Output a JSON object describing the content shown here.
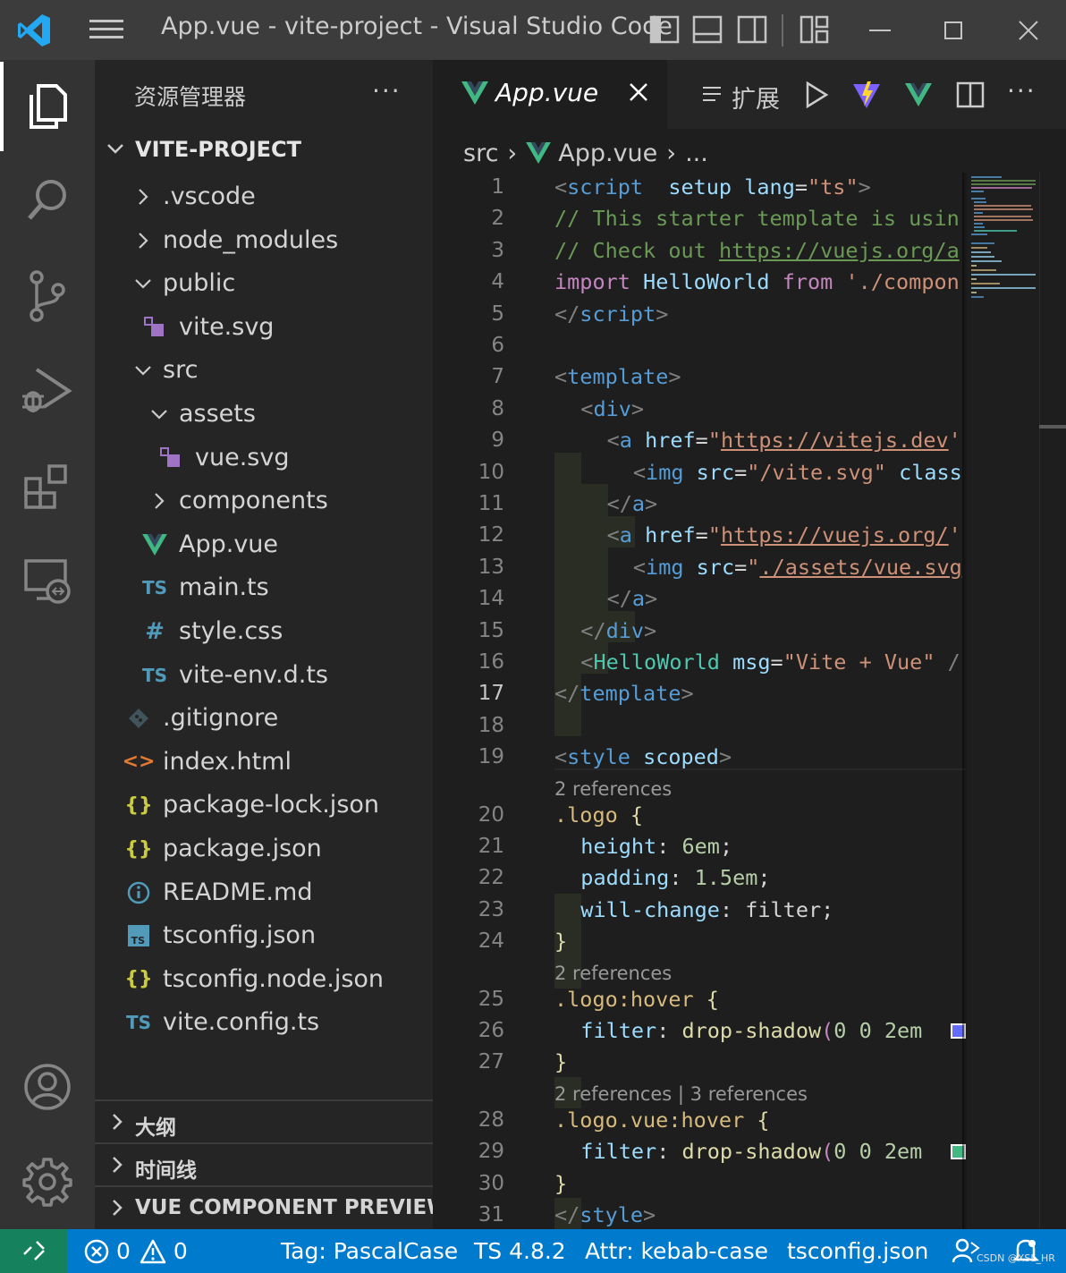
{
  "window": {
    "title": "App.vue - vite-project - Visual Studio Code"
  },
  "activity_bar": {
    "items": [
      "explorer-icon",
      "search-icon",
      "source-control-icon",
      "run-debug-icon",
      "extensions-icon",
      "remote-explorer-icon"
    ],
    "bottom_items": [
      "account-icon",
      "settings-gear-icon"
    ]
  },
  "sidebar": {
    "header": "资源管理器",
    "more": "···",
    "project": "VITE-PROJECT",
    "tree": [
      {
        "label": ".vscode",
        "type": "folder",
        "expanded": false,
        "depth": 0
      },
      {
        "label": "node_modules",
        "type": "folder",
        "expanded": false,
        "depth": 0
      },
      {
        "label": "public",
        "type": "folder",
        "expanded": true,
        "depth": 0
      },
      {
        "label": "vite.svg",
        "type": "svg",
        "depth": 1
      },
      {
        "label": "src",
        "type": "folder",
        "expanded": true,
        "depth": 0
      },
      {
        "label": "assets",
        "type": "folder",
        "expanded": true,
        "depth": 1
      },
      {
        "label": "vue.svg",
        "type": "svg",
        "depth": 2
      },
      {
        "label": "components",
        "type": "folder",
        "expanded": false,
        "depth": 1
      },
      {
        "label": "App.vue",
        "type": "vue",
        "depth": 1
      },
      {
        "label": "main.ts",
        "type": "ts",
        "depth": 1
      },
      {
        "label": "style.css",
        "type": "css",
        "depth": 1
      },
      {
        "label": "vite-env.d.ts",
        "type": "ts",
        "depth": 1
      },
      {
        "label": ".gitignore",
        "type": "git",
        "depth": 0
      },
      {
        "label": "index.html",
        "type": "html",
        "depth": 0
      },
      {
        "label": "package-lock.json",
        "type": "json",
        "depth": 0
      },
      {
        "label": "package.json",
        "type": "json",
        "depth": 0
      },
      {
        "label": "README.md",
        "type": "info",
        "depth": 0
      },
      {
        "label": "tsconfig.json",
        "type": "tsconfig",
        "depth": 0
      },
      {
        "label": "tsconfig.node.json",
        "type": "json",
        "depth": 0
      },
      {
        "label": "vite.config.ts",
        "type": "ts",
        "depth": 0
      }
    ],
    "icon_glyphs": {
      "ts": "TS",
      "css": "#",
      "json": "{}",
      "html": "<>",
      "tsconfig": "TS",
      "info": "i"
    },
    "sections": [
      "大纲",
      "时间线",
      "VUE COMPONENT PREVIEW"
    ]
  },
  "tabs": {
    "active": {
      "label": "App.vue"
    },
    "preview": {
      "label": "扩展"
    }
  },
  "breadcrumb": {
    "parts": [
      "src",
      "App.vue",
      "..."
    ]
  },
  "code": {
    "current_line": "17",
    "line_numbers": [
      "1",
      "2",
      "3",
      "4",
      "5",
      "6",
      "7",
      "8",
      "9",
      "10",
      "11",
      "12",
      "13",
      "14",
      "15",
      "16",
      "17",
      "18",
      "19",
      "20",
      "21",
      "22",
      "23",
      "24",
      "25",
      "26",
      "27",
      "28",
      "29",
      "30",
      "31"
    ],
    "lines": [
      [
        [
          "t",
          "<"
        ],
        [
          "tg",
          "script"
        ],
        [
          "",
          "  "
        ],
        [
          "at",
          "setup"
        ],
        [
          "",
          " "
        ],
        [
          "at",
          "lang"
        ],
        [
          "",
          "="
        ],
        [
          "st",
          "\"ts\""
        ],
        [
          "t",
          ">"
        ]
      ],
      [
        [
          "cm",
          "// This starter template is usin"
        ]
      ],
      [
        [
          "cm",
          "// Check out "
        ],
        [
          "cm ul",
          "https://vuejs.org/a"
        ]
      ],
      [
        [
          "kw",
          "import"
        ],
        [
          "",
          " "
        ],
        [
          "pr",
          "HelloWorld"
        ],
        [
          "",
          " "
        ],
        [
          "kw",
          "from"
        ],
        [
          "",
          " "
        ],
        [
          "st",
          "'./compon"
        ]
      ],
      [
        [
          "t",
          "</"
        ],
        [
          "tg",
          "script"
        ],
        [
          "t",
          ">"
        ]
      ],
      [],
      [
        [
          "t",
          "<"
        ],
        [
          "tg",
          "template"
        ],
        [
          "t",
          ">"
        ]
      ],
      [
        [
          "",
          ""
        ],
        [
          "t",
          "<"
        ],
        [
          "tg",
          "div"
        ],
        [
          "t",
          ">"
        ]
      ],
      [
        [
          "",
          ""
        ],
        [
          "t",
          "<"
        ],
        [
          "tg",
          "a"
        ],
        [
          "",
          " "
        ],
        [
          "at",
          "href"
        ],
        [
          "",
          "="
        ],
        [
          "st",
          "\""
        ],
        [
          "st ul",
          "https://vitejs.dev"
        ],
        [
          "st",
          "'"
        ]
      ],
      [
        [
          "",
          ""
        ],
        [
          "t",
          "<"
        ],
        [
          "tg",
          "img"
        ],
        [
          "",
          " "
        ],
        [
          "at",
          "src"
        ],
        [
          "",
          "="
        ],
        [
          "st",
          "\"/vite.svg\""
        ],
        [
          "",
          " "
        ],
        [
          "at",
          "class"
        ]
      ],
      [
        [
          "",
          ""
        ],
        [
          "t",
          "</"
        ],
        [
          "tg",
          "a"
        ],
        [
          "t",
          ">"
        ]
      ],
      [
        [
          "",
          ""
        ],
        [
          "t",
          "<"
        ],
        [
          "tg",
          "a"
        ],
        [
          "",
          " "
        ],
        [
          "at",
          "href"
        ],
        [
          "",
          "="
        ],
        [
          "st",
          "\""
        ],
        [
          "st ul",
          "https://vuejs.org/"
        ],
        [
          "st",
          "'"
        ]
      ],
      [
        [
          "",
          ""
        ],
        [
          "t",
          "<"
        ],
        [
          "tg",
          "img"
        ],
        [
          "",
          " "
        ],
        [
          "at",
          "src"
        ],
        [
          "",
          "="
        ],
        [
          "st",
          "\""
        ],
        [
          "st ul",
          "./assets/vue.svg"
        ]
      ],
      [
        [
          "",
          ""
        ],
        [
          "t",
          "</"
        ],
        [
          "tg",
          "a"
        ],
        [
          "t",
          ">"
        ]
      ],
      [
        [
          "",
          ""
        ],
        [
          "t",
          "</"
        ],
        [
          "tg",
          "div"
        ],
        [
          "t",
          ">"
        ]
      ],
      [
        [
          "",
          ""
        ],
        [
          "t",
          "<"
        ],
        [
          "cmp",
          "HelloWorld"
        ],
        [
          "",
          " "
        ],
        [
          "at",
          "msg"
        ],
        [
          "",
          "="
        ],
        [
          "st",
          "\"Vite + Vue\""
        ],
        [
          "",
          " "
        ],
        [
          "t",
          "/"
        ]
      ],
      [
        [
          "t",
          "</"
        ],
        [
          "tg",
          "template"
        ],
        [
          "t",
          ">"
        ]
      ],
      [],
      [
        [
          "t",
          "<"
        ],
        [
          "tg",
          "style"
        ],
        [
          "",
          " "
        ],
        [
          "at",
          "scoped"
        ],
        [
          "t",
          ">"
        ]
      ],
      [
        [
          "cl",
          ".logo"
        ],
        [
          "",
          " "
        ],
        [
          "fn",
          "{"
        ]
      ],
      [
        [
          "",
          ""
        ],
        [
          "pr",
          "height"
        ],
        [
          "",
          ": "
        ],
        [
          "nu",
          "6em"
        ],
        [
          "",
          ";"
        ]
      ],
      [
        [
          "",
          ""
        ],
        [
          "pr",
          "padding"
        ],
        [
          "",
          ": "
        ],
        [
          "nu",
          "1.5em"
        ],
        [
          "",
          ";"
        ]
      ],
      [
        [
          "",
          ""
        ],
        [
          "pr",
          "will-change"
        ],
        [
          "",
          ": filter;"
        ]
      ],
      [
        [
          "fn",
          "}"
        ]
      ],
      [
        [
          "cl",
          ".logo:hover"
        ],
        [
          "",
          " "
        ],
        [
          "fn",
          "{"
        ]
      ],
      [
        [
          "",
          ""
        ],
        [
          "pr",
          "filter"
        ],
        [
          "",
          ": "
        ],
        [
          "fn",
          "drop-shadow"
        ],
        [
          "kw",
          "("
        ],
        [
          "nu",
          "0 0 2em"
        ]
      ],
      [
        [
          "fn",
          "}"
        ]
      ],
      [
        [
          "cl",
          ".logo.vue:hover"
        ],
        [
          "",
          " "
        ],
        [
          "fn",
          "{"
        ]
      ],
      [
        [
          "",
          ""
        ],
        [
          "pr",
          "filter"
        ],
        [
          "",
          ": "
        ],
        [
          "fn",
          "drop-shadow"
        ],
        [
          "kw",
          "("
        ],
        [
          "nu",
          "0 0 2em"
        ]
      ],
      [
        [
          "fn",
          "}"
        ]
      ],
      [
        [
          "t",
          "</"
        ],
        [
          "tg",
          "style"
        ],
        [
          "t",
          ">"
        ]
      ]
    ],
    "codelens": {
      "before_20": "2 references",
      "before_25": "2 references",
      "before_28": "2 references | 3 references"
    },
    "color_swatches": {
      "line_26": "#646cff",
      "line_29": "#42b883"
    }
  },
  "statusbar": {
    "errors": "0",
    "warnings": "0",
    "tag": "Tag: PascalCase",
    "ts_version": "TS 4.8.2",
    "attr": "Attr: kebab-case",
    "tsconfig": "tsconfig.json",
    "watermark": "CSDN @XSL_HR"
  },
  "colors": {
    "titlebar": "#3c3c3c",
    "activitybar": "#333333",
    "sidebar": "#252526",
    "editor": "#1e1e1e",
    "statusbar": "#007acc",
    "remote": "#16825d",
    "vscode_blue": "#23a9f2",
    "vue_green": "#41b883"
  }
}
